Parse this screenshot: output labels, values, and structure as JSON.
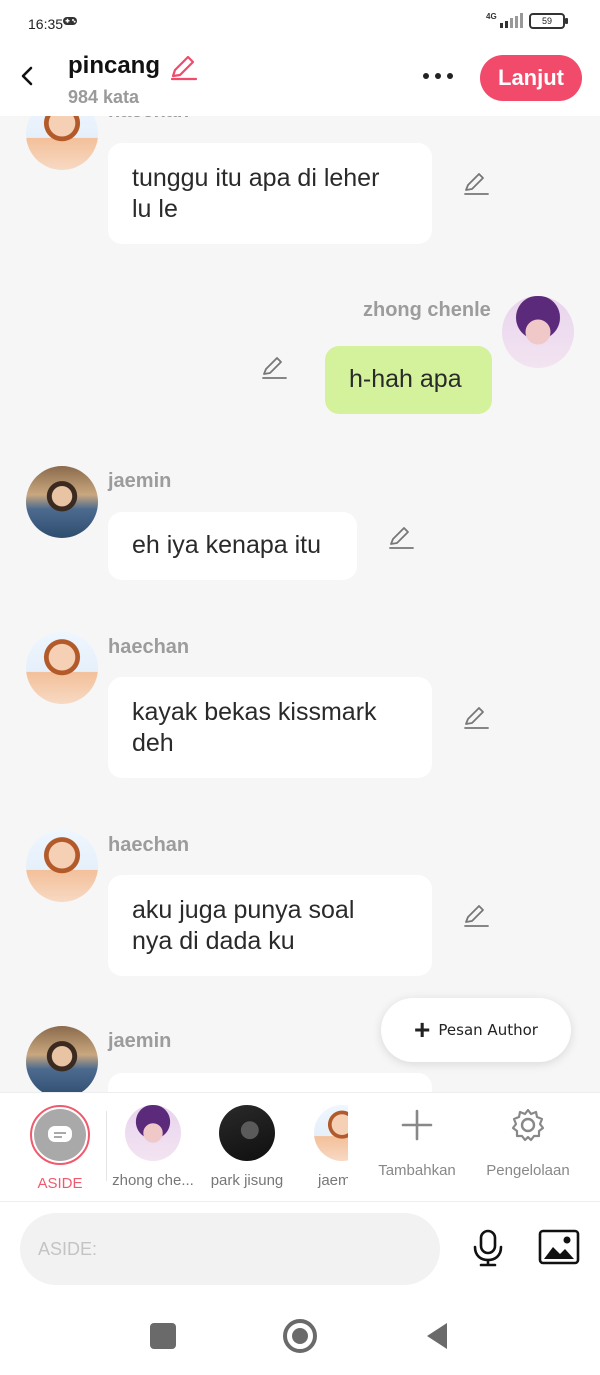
{
  "status_bar": {
    "time": "16:35",
    "network": "4G",
    "battery": "59"
  },
  "header": {
    "title": "pincang",
    "word_count": "984 kata",
    "continue_label": "Lanjut"
  },
  "messages": [
    {
      "sender": "haechan",
      "text_lines": [
        "tunggu itu apa di leher",
        "lu le"
      ],
      "side": "left"
    },
    {
      "sender": "zhong chenle",
      "text_lines": [
        "h-hah apa"
      ],
      "side": "right"
    },
    {
      "sender": "jaemin",
      "text_lines": [
        "eh iya kenapa itu"
      ],
      "side": "left"
    },
    {
      "sender": "haechan",
      "text_lines": [
        "kayak bekas kissmark",
        "deh"
      ],
      "side": "left"
    },
    {
      "sender": "haechan",
      "text_lines": [
        "aku juga punya soal",
        "nya di dada ku"
      ],
      "side": "left"
    },
    {
      "sender": "jaemin",
      "text_lines": [],
      "side": "left"
    }
  ],
  "floating": {
    "pesan_author_label": "Pesan Author"
  },
  "characters": {
    "aside_label": "ASIDE",
    "items": [
      {
        "name": "zhong che..."
      },
      {
        "name": "park jisung"
      },
      {
        "name": "jaem"
      }
    ],
    "add_label": "Tambahkan",
    "manage_label": "Pengelolaan"
  },
  "input": {
    "placeholder": "ASIDE:"
  },
  "colors": {
    "accent": "#f14a6b",
    "my_bubble": "#d4f29b",
    "other_bubble": "#ffffff"
  }
}
